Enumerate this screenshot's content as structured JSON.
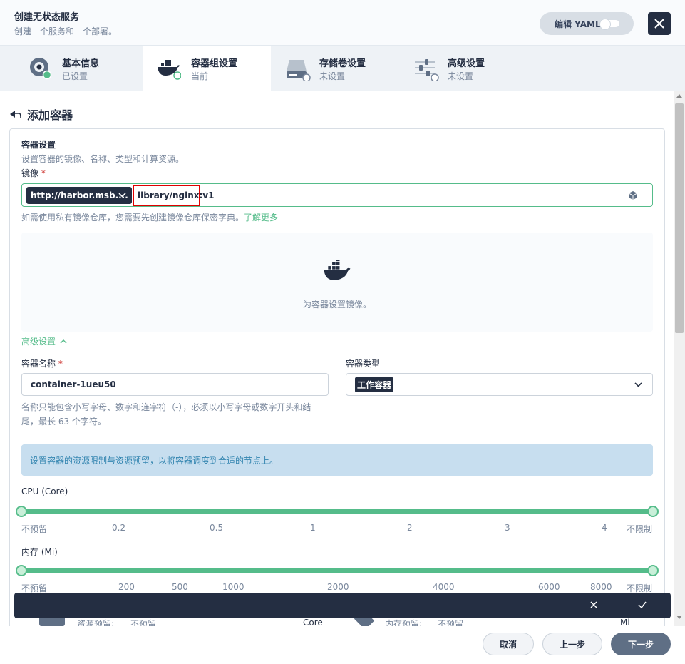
{
  "header": {
    "title": "创建无状态服务",
    "description": "创建一个服务和一个部署。",
    "yaml_label": "编辑 YAML"
  },
  "steps": [
    {
      "label": "基本信息",
      "status": "已设置",
      "icon": "info-gear-icon"
    },
    {
      "label": "容器组设置",
      "status": "当前",
      "icon": "docker-icon"
    },
    {
      "label": "存储卷设置",
      "status": "未设置",
      "icon": "disk-icon"
    },
    {
      "label": "高级设置",
      "status": "未设置",
      "icon": "sliders-icon"
    }
  ],
  "page": {
    "back_title": "添加容器"
  },
  "container": {
    "section_title": "容器设置",
    "section_desc": "设置容器的镜像、名称、类型和计算资源。",
    "image_label": "镜像",
    "registry": "http://harbor.msb....",
    "image_value": "library/nginx:v1",
    "private_hint": "如需使用私有镜像仓库，您需要先创建镜像仓库保密字典。",
    "learn_more": "了解更多",
    "empty_hint": "为容器设置镜像。",
    "advanced_label": "高级设置",
    "name_label": "容器名称",
    "name_value": "container-1ueu50",
    "name_hint_1": "名称只能包含小写字母、数字和连字符（-），必须以小写字母或数字开头和结",
    "name_hint_2": "尾，最长 63 个字符。",
    "type_label": "容器类型",
    "type_value": "工作容器",
    "resource_info": "设置容器的资源限制与资源预留，以将容器调度到合适的节点上。"
  },
  "cpu": {
    "label": "CPU (Core)",
    "ticks": [
      "不预留",
      "0.2",
      "0.5",
      "1",
      "2",
      "3",
      "4",
      "不限制"
    ]
  },
  "memory": {
    "label": "内存 (Mi)",
    "ticks": [
      "不预留",
      "200",
      "500",
      "1000",
      "2000",
      "4000",
      "6000",
      "8000",
      "不限制"
    ]
  },
  "peek": {
    "cpu_reserve_label": "资源预留:",
    "cpu_reserve_value": "不预留",
    "cpu_unit": "Core",
    "mem_reserve_label": "内存预留:",
    "mem_reserve_value": "不预留",
    "mem_unit": "Mi"
  },
  "footer": {
    "cancel": "取消",
    "prev": "上一步",
    "next": "下一步"
  },
  "colors": {
    "accent": "#55bc8a",
    "dark": "#242e42",
    "highlight_box": "#e00000"
  }
}
